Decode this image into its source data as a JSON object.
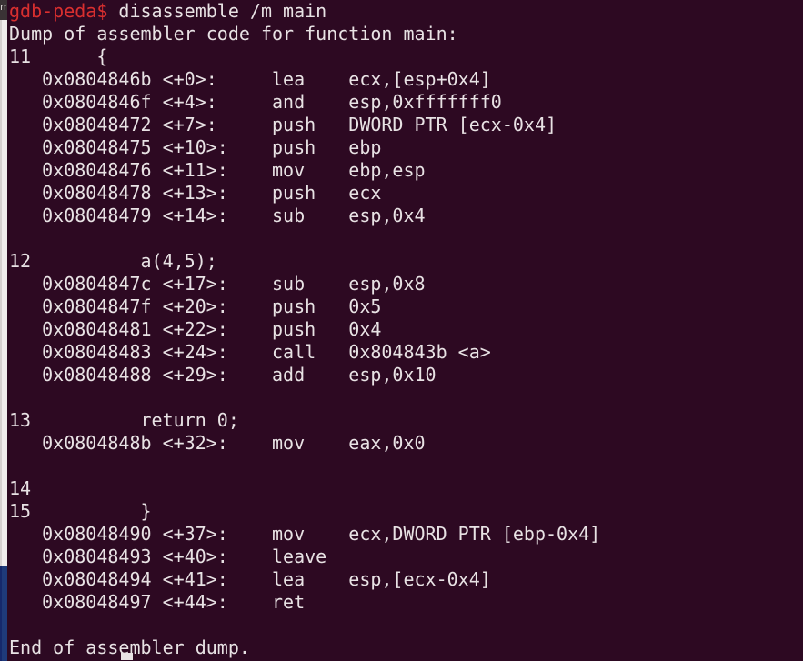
{
  "window": {
    "background_color": "#2d0922",
    "foreground_color": "#e8e2e4",
    "prompt_color": "#d92f2f",
    "background_window_gray_color": "#f2eeee",
    "background_window_blue_color": "#1f3a7a",
    "bg_window_glyph": "m"
  },
  "terminal": {
    "prompt": "gdb-peda$",
    "command": " disassemble /m main",
    "lines": [
      {
        "text": "Dump of assembler code for function main:"
      },
      {
        "text": "11\t{"
      },
      {
        "text": "   0x0804846b <+0>:\tlea    ecx,[esp+0x4]"
      },
      {
        "text": "   0x0804846f <+4>:\tand    esp,0xfffffff0"
      },
      {
        "text": "   0x08048472 <+7>:\tpush   DWORD PTR [ecx-0x4]"
      },
      {
        "text": "   0x08048475 <+10>:\tpush   ebp"
      },
      {
        "text": "   0x08048476 <+11>:\tmov    ebp,esp"
      },
      {
        "text": "   0x08048478 <+13>:\tpush   ecx"
      },
      {
        "text": "   0x08048479 <+14>:\tsub    esp,0x4"
      },
      {
        "text": ""
      },
      {
        "text": "12\t    a(4,5);"
      },
      {
        "text": "   0x0804847c <+17>:\tsub    esp,0x8"
      },
      {
        "text": "   0x0804847f <+20>:\tpush   0x5"
      },
      {
        "text": "   0x08048481 <+22>:\tpush   0x4"
      },
      {
        "text": "   0x08048483 <+24>:\tcall   0x804843b <a>"
      },
      {
        "text": "   0x08048488 <+29>:\tadd    esp,0x10"
      },
      {
        "text": ""
      },
      {
        "text": "13\t    return 0;"
      },
      {
        "text": "   0x0804848b <+32>:\tmov    eax,0x0"
      },
      {
        "text": ""
      },
      {
        "text": "14\t"
      },
      {
        "text": "15\t    }"
      },
      {
        "text": "   0x08048490 <+37>:\tmov    ecx,DWORD PTR [ebp-0x4]"
      },
      {
        "text": "   0x08048493 <+40>:\tleave"
      },
      {
        "text": "   0x08048494 <+41>:\tlea    esp,[ecx-0x4]"
      },
      {
        "text": "   0x08048497 <+44>:\tret"
      },
      {
        "text": ""
      },
      {
        "text": "End of assembler dump."
      }
    ]
  }
}
